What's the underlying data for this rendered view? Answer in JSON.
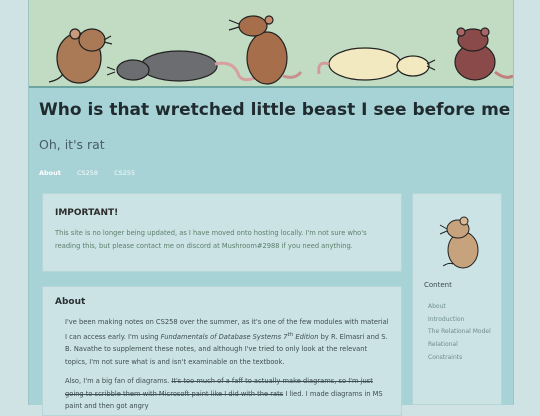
{
  "site": {
    "title": "Who is that wretched little beast I see before me",
    "subtitle": "Oh, it's rat"
  },
  "nav": {
    "items": [
      {
        "label": "About",
        "active": true
      },
      {
        "label": "CS258",
        "active": false
      },
      {
        "label": "CS255",
        "active": false
      }
    ]
  },
  "notice": {
    "heading": "IMPORTANT!",
    "text": "This site is no longer being updated, as I have moved onto hosting locally. I'm not sure who's reading this, but please contact me on discord at Mushroom#2988 if you need anything."
  },
  "about": {
    "heading": "About",
    "p1_a": "I've been making notes on CS258 over the summer, as it's one of the few modules with material I can access early. I'm using ",
    "p1_book": "Fundamentals of Database Systems 7",
    "p1_sup": "th",
    "p1_edition": " Edition",
    "p1_b": " by R. Elmasri and S. B. Navathe to supplement these notes, and although I've tried to only look at the relevant topics, I'm not sure what is and isn't examinable on the textbook.",
    "p2_a": "Also, I'm a big fan of diagrams. ",
    "p2_strike": "It's too much of a faff to actually make diagrams, so I'm just going to scribble them with Microsoft paint like I did with the rats",
    "p2_b": " I lied. I made diagrams in MS paint and then got angry"
  },
  "sidebar": {
    "heading": "Content",
    "items": [
      "About",
      "Introduction",
      "The Relational Model",
      "Relational",
      "Constraints"
    ]
  },
  "colors": {
    "page_bg": "#a8d3d6",
    "card_bg": "#cbe3e4",
    "banner_bg": "#c2dcc3"
  }
}
